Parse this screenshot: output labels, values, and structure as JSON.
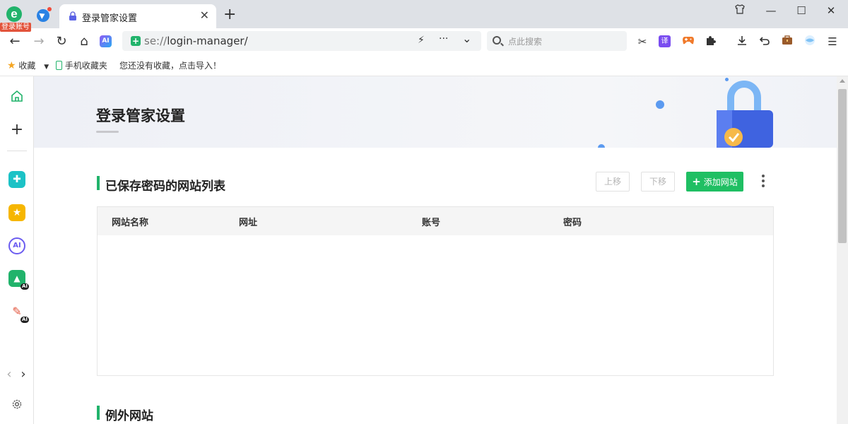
{
  "browser": {
    "login_badge": "登录账号",
    "tab": {
      "title": "登录管家设置",
      "close": "✕"
    },
    "new_tab": "+",
    "url": {
      "scheme": "se://",
      "path": "login-manager/"
    },
    "search_placeholder": "点此搜索",
    "icons": {
      "back": "←",
      "forward": "→",
      "reload": "↻",
      "home": "⌂",
      "ai": "AI",
      "lightning": "⚡",
      "more": "···",
      "dropdown": "⌄",
      "cut": "✂",
      "translate": "译",
      "game": "🎮",
      "extension": "✚",
      "download": "⤓",
      "undo": "↶",
      "briefcase": "💼",
      "menu": "☰",
      "shirt": "👕",
      "minimize": "—",
      "maximize": "☐",
      "close": "✕"
    }
  },
  "bookmarks": {
    "favorites": "收藏",
    "mobile": "手机收藏夹",
    "empty_hint": "您还没有收藏，点击导入！"
  },
  "page": {
    "title": "登录管家设置",
    "saved_section": {
      "title": "已保存密码的网站列表",
      "move_up": "上移",
      "move_down": "下移",
      "add_site": "添加网站",
      "add_icon": "+",
      "columns": [
        "网站名称",
        "网址",
        "账号",
        "密码"
      ],
      "rows": []
    },
    "exceptions_section": {
      "title": "例外网站"
    }
  },
  "colors": {
    "accent": "#1fbf63",
    "section_bar": "#21b36b",
    "login_badge": "#e2533b"
  }
}
